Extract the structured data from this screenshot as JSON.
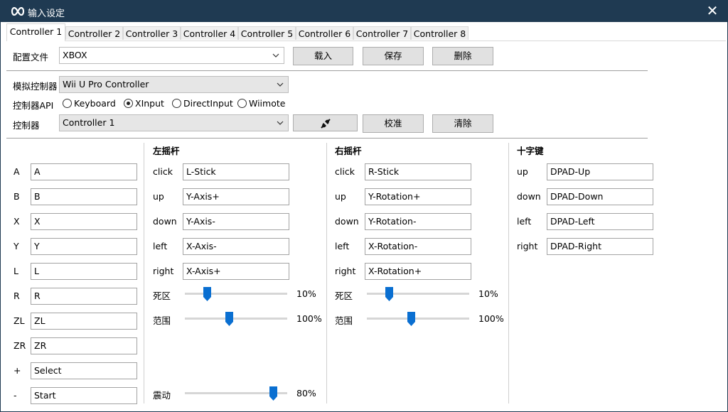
{
  "window": {
    "title": "输入设定",
    "close_glyph": "✕",
    "titlebar_color": "#1f3a52",
    "icon": "gamepad-infinity-icon"
  },
  "tabs": [
    {
      "label": "Controller 1",
      "active": true
    },
    {
      "label": "Controller 2"
    },
    {
      "label": "Controller 3"
    },
    {
      "label": "Controller 4"
    },
    {
      "label": "Controller 5"
    },
    {
      "label": "Controller 6"
    },
    {
      "label": "Controller 7"
    },
    {
      "label": "Controller 8"
    }
  ],
  "profile": {
    "label": "配置文件",
    "value": "XBOX",
    "load_label": "载入",
    "save_label": "保存",
    "delete_label": "删除"
  },
  "emulated": {
    "label": "模拟控制器",
    "value": "Wii U Pro Controller"
  },
  "api": {
    "label": "控制器API",
    "options": [
      {
        "label": "Keyboard",
        "selected": false
      },
      {
        "label": "XInput",
        "selected": true
      },
      {
        "label": "DirectInput",
        "selected": false
      },
      {
        "label": "Wiimote",
        "selected": false
      }
    ]
  },
  "controller": {
    "label": "控制器",
    "value": "Controller 1",
    "connect_icon": "plug-connect-icon",
    "calibrate_label": "校准",
    "clear_label": "清除"
  },
  "buttons": [
    {
      "name": "A",
      "value": "A"
    },
    {
      "name": "B",
      "value": "B"
    },
    {
      "name": "X",
      "value": "X"
    },
    {
      "name": "Y",
      "value": "Y"
    },
    {
      "name": "L",
      "value": "L"
    },
    {
      "name": "R",
      "value": "R"
    },
    {
      "name": "ZL",
      "value": "ZL"
    },
    {
      "name": "ZR",
      "value": "ZR"
    },
    {
      "name": "+",
      "value": "Select"
    },
    {
      "name": "-",
      "value": "Start"
    }
  ],
  "left_stick": {
    "title": "左摇杆",
    "rows": [
      {
        "name": "click",
        "value": "L-Stick"
      },
      {
        "name": "up",
        "value": "Y-Axis+"
      },
      {
        "name": "down",
        "value": "Y-Axis-"
      },
      {
        "name": "left",
        "value": "X-Axis-"
      },
      {
        "name": "right",
        "value": "X-Axis+"
      }
    ],
    "deadzone_label": "死区",
    "deadzone_value": "10%",
    "deadzone_fraction": 0.1,
    "range_label": "范围",
    "range_value": "100%",
    "range_fraction": 0.333
  },
  "right_stick": {
    "title": "右摇杆",
    "rows": [
      {
        "name": "click",
        "value": "R-Stick"
      },
      {
        "name": "up",
        "value": "Y-Rotation+"
      },
      {
        "name": "down",
        "value": "Y-Rotation-"
      },
      {
        "name": "left",
        "value": "X-Rotation-"
      },
      {
        "name": "right",
        "value": "X-Rotation+"
      }
    ],
    "deadzone_label": "死区",
    "deadzone_value": "10%",
    "deadzone_fraction": 0.1,
    "range_label": "范围",
    "range_value": "100%",
    "range_fraction": 0.333
  },
  "dpad": {
    "title": "十字键",
    "rows": [
      {
        "name": "up",
        "value": "DPAD-Up"
      },
      {
        "name": "down",
        "value": "DPAD-Down"
      },
      {
        "name": "left",
        "value": "DPAD-Left"
      },
      {
        "name": "right",
        "value": "DPAD-Right"
      }
    ]
  },
  "rumble": {
    "label": "震动",
    "value": "80%",
    "fraction": 0.8
  },
  "colors": {
    "slider_thumb": "#0a6fd1"
  }
}
